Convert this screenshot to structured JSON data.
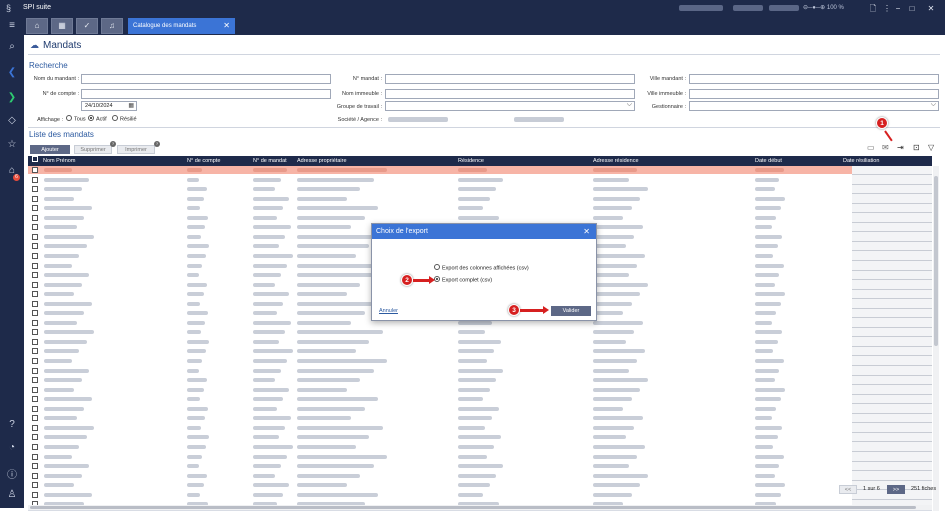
{
  "app": {
    "title": "SPI suite",
    "zoom": "100 %"
  },
  "window_controls": {
    "minimize": "−",
    "maximize": "□",
    "close": "✕"
  },
  "tabs": {
    "active_label": "Catalogue des mandats",
    "close": "✕"
  },
  "page": {
    "title": "Mandats"
  },
  "search": {
    "section_title": "Recherche",
    "labels": {
      "nom_mandant": "Nom du mandant :",
      "num_compte": "N° de compte :",
      "num_mandat": "N° mandat :",
      "nom_immeuble": "Nom immeuble :",
      "groupe_travail": "Groupe de travail :",
      "societe_agence": "Société / Agence :",
      "ville_mandant": "Ville mandant :",
      "ville_immeuble": "Ville immeuble :",
      "gestionnaire": "Gestionnaire :",
      "affichage": "Affichage :"
    },
    "date_value": "24/10/2024",
    "affichage_options": [
      "Tous",
      "Actif",
      "Résilié"
    ]
  },
  "list": {
    "section_title": "Liste des mandats",
    "buttons": {
      "add": "Ajouter",
      "delete": "Supprimer",
      "print": "Imprimer"
    },
    "columns": [
      "Nom Prénom",
      "N° de compte",
      "N° de mandat",
      "Adresse propriétaire",
      "Résidence",
      "Adresse résidence",
      "Date début",
      "Date résiliation"
    ]
  },
  "pager": {
    "prev": "<<",
    "info": "1 sur 6",
    "next": ">>",
    "count": "251 fiches"
  },
  "modal": {
    "title": "Choix de l'export",
    "close": "✕",
    "option_displayed": "Export des colonnes affichées (csv)",
    "option_full": "Export complet (csv)",
    "cancel": "Annuler",
    "validate": "Valider"
  },
  "markers": [
    "1",
    "2",
    "3"
  ],
  "colors": {
    "nav": "#1e2a4a",
    "accent": "#3b74d6",
    "highlight_row": "#f7b4a6",
    "marker": "#d62020"
  }
}
